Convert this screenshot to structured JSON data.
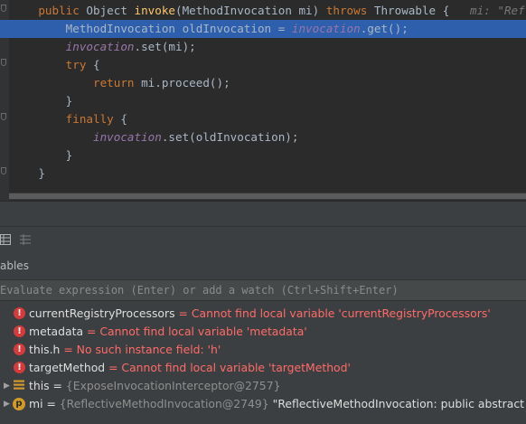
{
  "editor": {
    "lines": [
      {
        "indent": "    ",
        "parts": [
          [
            "kw",
            "public "
          ],
          [
            "plain",
            "Object "
          ],
          [
            "fn",
            "invoke"
          ],
          [
            "plain",
            "(MethodInvocation mi) "
          ],
          [
            "kw",
            "throws "
          ],
          [
            "plain",
            "Throwable {   "
          ],
          [
            "hint",
            "mi: \"ReflectiveMethodInvocation"
          ]
        ]
      },
      {
        "indent": "        ",
        "parts": [
          [
            "plain",
            "MethodInvocation oldInvocation = "
          ],
          [
            "fld",
            "invocation"
          ],
          [
            "plain",
            ".get();"
          ]
        ],
        "highlight": true
      },
      {
        "indent": "        ",
        "parts": [
          [
            "fld",
            "invocation"
          ],
          [
            "plain",
            ".set(mi);"
          ]
        ]
      },
      {
        "indent": "        ",
        "parts": [
          [
            "kw",
            "try "
          ],
          [
            "plain",
            "{"
          ]
        ]
      },
      {
        "indent": "            ",
        "parts": [
          [
            "kw",
            "return "
          ],
          [
            "plain",
            "mi.proceed();"
          ]
        ]
      },
      {
        "indent": "        ",
        "parts": [
          [
            "plain",
            "}"
          ]
        ]
      },
      {
        "indent": "        ",
        "parts": [
          [
            "kw",
            "finally "
          ],
          [
            "plain",
            "{"
          ]
        ]
      },
      {
        "indent": "            ",
        "parts": [
          [
            "fld",
            "invocation"
          ],
          [
            "plain",
            ".set(oldInvocation);"
          ]
        ]
      },
      {
        "indent": "        ",
        "parts": [
          [
            "plain",
            "}"
          ]
        ]
      },
      {
        "indent": "    ",
        "parts": [
          [
            "plain",
            "}"
          ]
        ]
      }
    ]
  },
  "debugger": {
    "variables_header": "ables",
    "watch_placeholder": "Evaluate expression (Enter) or add a watch (Ctrl+Shift+Enter)",
    "toolbar_icons": [
      "table-view-icon",
      "settings-list-icon"
    ]
  },
  "variables": [
    {
      "kind": "error",
      "name": "currentRegistryProcessors",
      "eq": " = ",
      "value": "Cannot find local variable 'currentRegistryProcessors'"
    },
    {
      "kind": "error",
      "name": "metadata",
      "eq": " = ",
      "value": "Cannot find local variable 'metadata'"
    },
    {
      "kind": "error",
      "name": "this.h",
      "eq": " = ",
      "value": "No such instance field: 'h'"
    },
    {
      "kind": "error",
      "name": "targetMethod",
      "eq": " = ",
      "value": "Cannot find local variable 'targetMethod'"
    },
    {
      "kind": "object",
      "name": "this",
      "eq": " = ",
      "value": "{ExposeInvocationInterceptor@2757}"
    },
    {
      "kind": "param",
      "name": "mi",
      "eq": " = ",
      "value": "{ReflectiveMethodInvocation@2749}",
      "extra": " \"ReflectiveMethodInvocation: public abstract void co"
    }
  ],
  "colors": {
    "highlight": "#2d5fad",
    "error": "#ff6b68",
    "keyword": "#cc7832",
    "field": "#9876aa"
  }
}
